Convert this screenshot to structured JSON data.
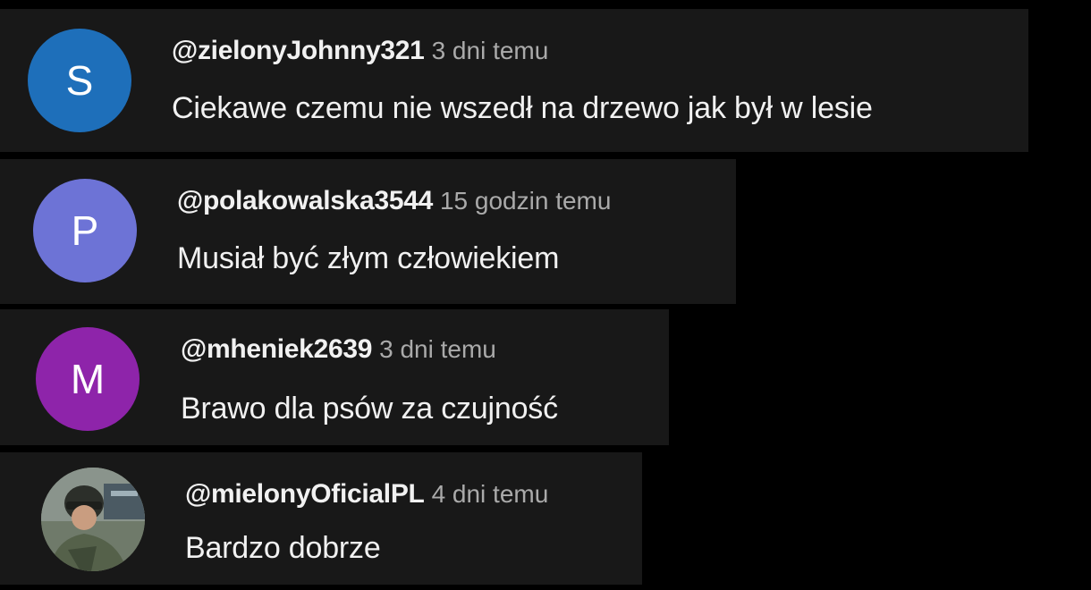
{
  "comments": [
    {
      "author": "@zielonyJohnny321",
      "time": "3 dni temu",
      "text": "Ciekawe czemu nie wszedł na drzewo jak był w lesie",
      "avatar_letter": "S",
      "avatar_color": "#1e6fba"
    },
    {
      "author": "@polakowalska3544",
      "time": "15 godzin temu",
      "text": "Musiał być złym człowiekiem",
      "avatar_letter": "P",
      "avatar_color": "#6d73d6"
    },
    {
      "author": "@mheniek2639",
      "time": "3 dni temu",
      "text": "Brawo dla psów za czujność",
      "avatar_letter": "M",
      "avatar_color": "#8e24aa"
    },
    {
      "author": "@mielonyOficialPL",
      "time": "4 dni temu",
      "text": "Bardzo dobrze",
      "avatar_letter": "",
      "avatar_color": "#5a6650"
    }
  ]
}
